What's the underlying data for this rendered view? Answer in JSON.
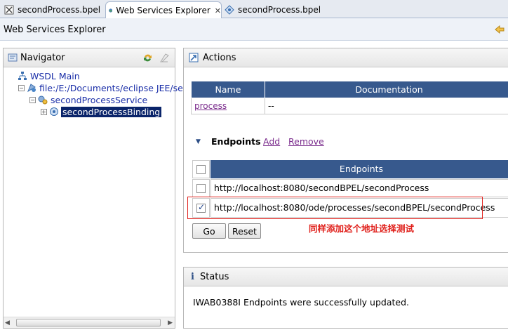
{
  "tabs": [
    {
      "label": "secondProcess.bpel",
      "icon": "bpel-file-icon"
    },
    {
      "label": "Web Services Explorer",
      "icon": "globe-icon"
    },
    {
      "label": "secondProcess.bpel",
      "icon": "process-diagram-icon"
    }
  ],
  "title": "Web Services Explorer",
  "navigator": {
    "title": "Navigator",
    "tree": [
      {
        "label": "WSDL Main"
      },
      {
        "label": "file:/E:/Documents/eclipse JEE/se"
      },
      {
        "label": "secondProcessService"
      },
      {
        "label": "secondProcessBinding"
      }
    ]
  },
  "actions": {
    "title": "Actions",
    "operations_table": {
      "columns": [
        "Name",
        "Documentation"
      ],
      "rows": [
        {
          "name": "process",
          "doc": "--"
        }
      ]
    },
    "endpoints": {
      "heading": "Endpoints",
      "add": "Add",
      "remove": "Remove",
      "column": "Endpoints",
      "rows": [
        {
          "url": "http://localhost:8080/secondBPEL/secondProcess",
          "checked": false
        },
        {
          "url": "http://localhost:8080/ode/processes/secondBPEL/secondProcess",
          "checked": true
        }
      ]
    },
    "go": "Go",
    "reset": "Reset",
    "annotation": "同样添加这个地址选择测试"
  },
  "status": {
    "title": "Status",
    "message": "IWAB0388I Endpoints were successfully updated."
  },
  "colors": {
    "table_header": "#37598d",
    "link": "#1a2ea8",
    "visited_link": "#7a2b8c",
    "annotation": "#e0201b",
    "selection": "#0a246a"
  }
}
